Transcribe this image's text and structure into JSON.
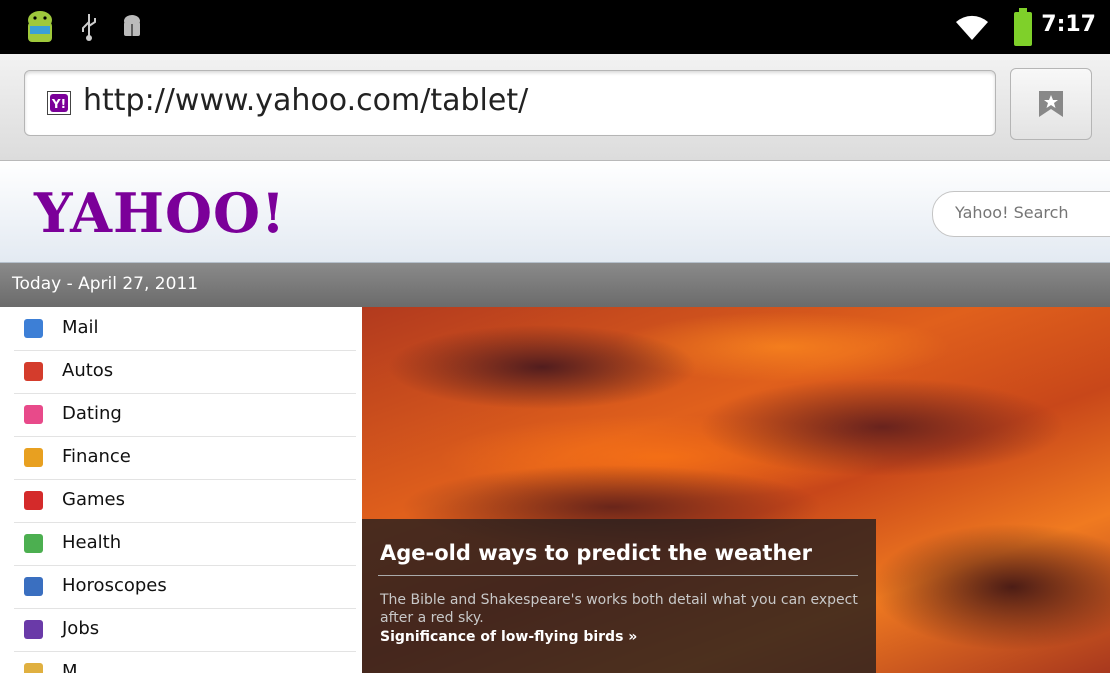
{
  "status_bar": {
    "time": "7:17",
    "icons": [
      "android-robot-icon",
      "usb-icon",
      "debug-icon",
      "wifi-icon",
      "battery-icon"
    ]
  },
  "url_bar": {
    "url": "http://www.yahoo.com/tablet/",
    "favicon": "yahoo-favicon-icon",
    "bookmark_icon": "bookmark-icon"
  },
  "header": {
    "logo_text": "YAHOO!",
    "logo_color": "#7b0099",
    "search_placeholder": "Yahoo! Search"
  },
  "date_bar": {
    "text": "Today - April 27, 2011"
  },
  "sidebar": {
    "items": [
      {
        "label": "Mail",
        "icon": "mail-icon",
        "color": "#3d7fd6"
      },
      {
        "label": "Autos",
        "icon": "car-icon",
        "color": "#d43c2c"
      },
      {
        "label": "Dating",
        "icon": "heart-icon",
        "color": "#e84a8a"
      },
      {
        "label": "Finance",
        "icon": "chart-icon",
        "color": "#e8a020"
      },
      {
        "label": "Games",
        "icon": "dice-icon",
        "color": "#d42a2a"
      },
      {
        "label": "Health",
        "icon": "health-icon",
        "color": "#4caf50"
      },
      {
        "label": "Horoscopes",
        "icon": "horoscope-icon",
        "color": "#3a6fc0"
      },
      {
        "label": "Jobs",
        "icon": "jobs-icon",
        "color": "#6a3aa8"
      },
      {
        "label": "M...",
        "icon": "maps-icon",
        "color": "#e0b040"
      }
    ]
  },
  "hero": {
    "title": "Age-old ways to predict the weather",
    "body": "The Bible and Shakespeare's works both detail what you can expect after a red sky.",
    "link": "Significance of low-flying birds »"
  }
}
